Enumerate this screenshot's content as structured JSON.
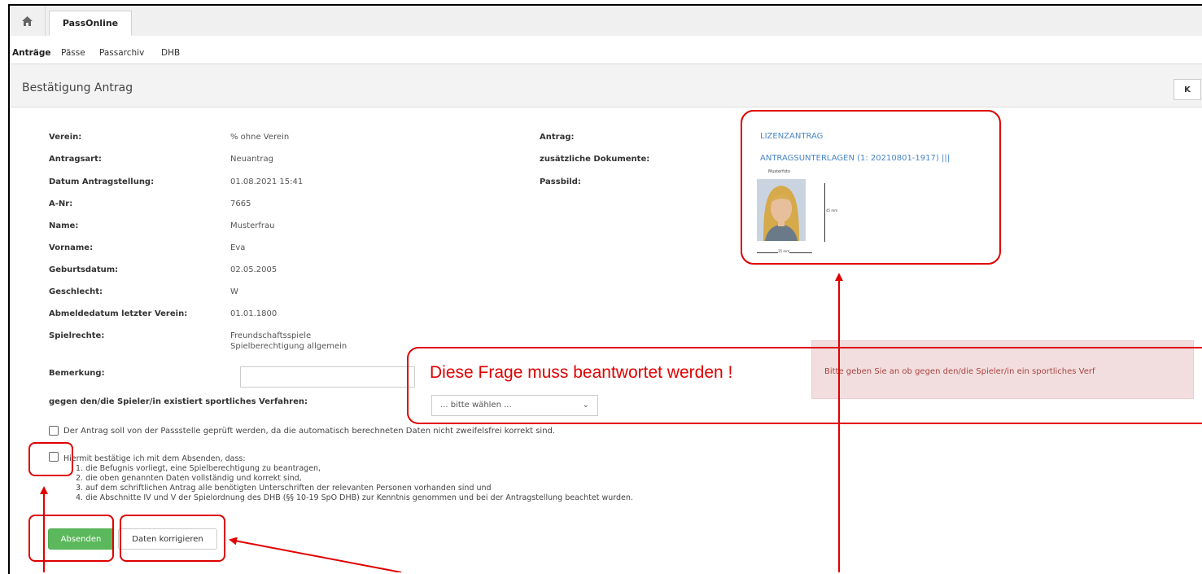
{
  "tabs": {
    "home_icon": "home-icon",
    "app_tab": "PassOnline"
  },
  "subnav": [
    "Anträge",
    "Pässe",
    "Passarchiv",
    "DHB"
  ],
  "header": {
    "title": "Bestätigung Antrag",
    "nav_button": "K"
  },
  "fields_left": [
    {
      "label": "Verein:",
      "value": "% ohne Verein"
    },
    {
      "label": "Antragsart:",
      "value": "Neuantrag"
    },
    {
      "label": "Datum Antragstellung:",
      "value": "01.08.2021 15:41"
    },
    {
      "label": "A-Nr:",
      "value": "7665"
    },
    {
      "label": "Name:",
      "value": "Musterfrau"
    },
    {
      "label": "Vorname:",
      "value": "Eva"
    },
    {
      "label": "Geburtsdatum:",
      "value": "02.05.2005"
    },
    {
      "label": "Geschlecht:",
      "value": "W"
    },
    {
      "label": "Abmeldedatum letzter Verein:",
      "value": "01.01.1800"
    },
    {
      "label": "Spielrechte:",
      "value": "Freundschaftsspiele",
      "value2": "Spielberechtigung allgemein"
    }
  ],
  "fields_right": {
    "antrag_label": "Antrag:",
    "antrag_link": "LIZENZANTRAG",
    "docs_label": "zusätzliche Dokumente:",
    "docs_link": "ANTRAGSUNTERLAGEN (1: 20210801-1917) |||",
    "photo_label": "Passbild:",
    "photo_caption": "Musterfoto",
    "photo_height": "45 mm",
    "photo_width": "35 mm"
  },
  "remark": {
    "label": "Bemerkung:",
    "value": ""
  },
  "proceedings": {
    "label": "gegen den/die Spieler/in existiert sportliches Verfahren:",
    "selected": "... bitte wählen ..."
  },
  "error": {
    "callout": "Diese Frage muss beantwortet werden !",
    "message": "Bitte geben Sie an ob gegen den/die Spieler/in ein sportliches Verf"
  },
  "check_review": "Der Antrag soll von der Passstelle geprüft werden, da die automatisch berechneten Daten nicht zweifelsfrei korrekt sind.",
  "check_confirm": {
    "intro": "Hiermit bestätige ich mit dem Absenden, dass:",
    "items": [
      "1. die Befugnis vorliegt, eine Spielberechtigung zu beantragen,",
      "2. die oben genannten Daten vollständig und korrekt sind,",
      "3. auf dem schriftlichen Antrag alle benötigten Unterschriften der relevanten Personen vorhanden sind und",
      "4. die Abschnitte IV und V der Spielordnung des DHB (§§ 10-19 SpO DHB) zur Kenntnis genommen und bei der Antragstellung beachtet wurden."
    ]
  },
  "buttons": {
    "submit": "Absenden",
    "correct": "Daten korrigieren"
  },
  "colors": {
    "annotation": "#e00000",
    "submit": "#5cb85c",
    "link": "#4a86c5",
    "error_bg": "#f2dede",
    "error_text": "#a94442"
  }
}
